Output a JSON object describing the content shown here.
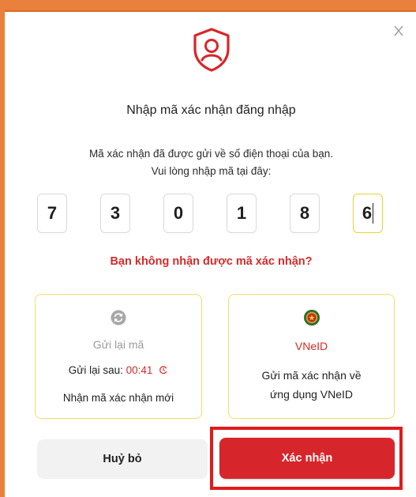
{
  "dialog": {
    "title": "Nhập mã xác nhận đăng nhập",
    "description_line1": "Mã xác nhận đã được gửi về số điện thoại của bạn.",
    "description_line2": "Vui lòng nhập mã tại đây:",
    "otp_digits": [
      "7",
      "3",
      "0",
      "1",
      "8",
      "6"
    ],
    "not_received": "Bạn không nhận được mã xác nhận?",
    "accent_color": "#d42b2b"
  },
  "resend_card": {
    "icon": "refresh-icon",
    "name": "Gửi lại mã",
    "timer_label": "Gửi lại sau: ",
    "timer_value": "00:41",
    "subtitle": "Nhận mã xác nhận mới"
  },
  "vneid_card": {
    "icon": "vneid-emblem-icon",
    "name": "VNeID",
    "subtitle_line1": "Gửi mã xác nhận về",
    "subtitle_line2": "ứng dụng VNeID"
  },
  "buttons": {
    "cancel_label": "Huỷ bỏ",
    "confirm_label": "Xác nhận"
  }
}
